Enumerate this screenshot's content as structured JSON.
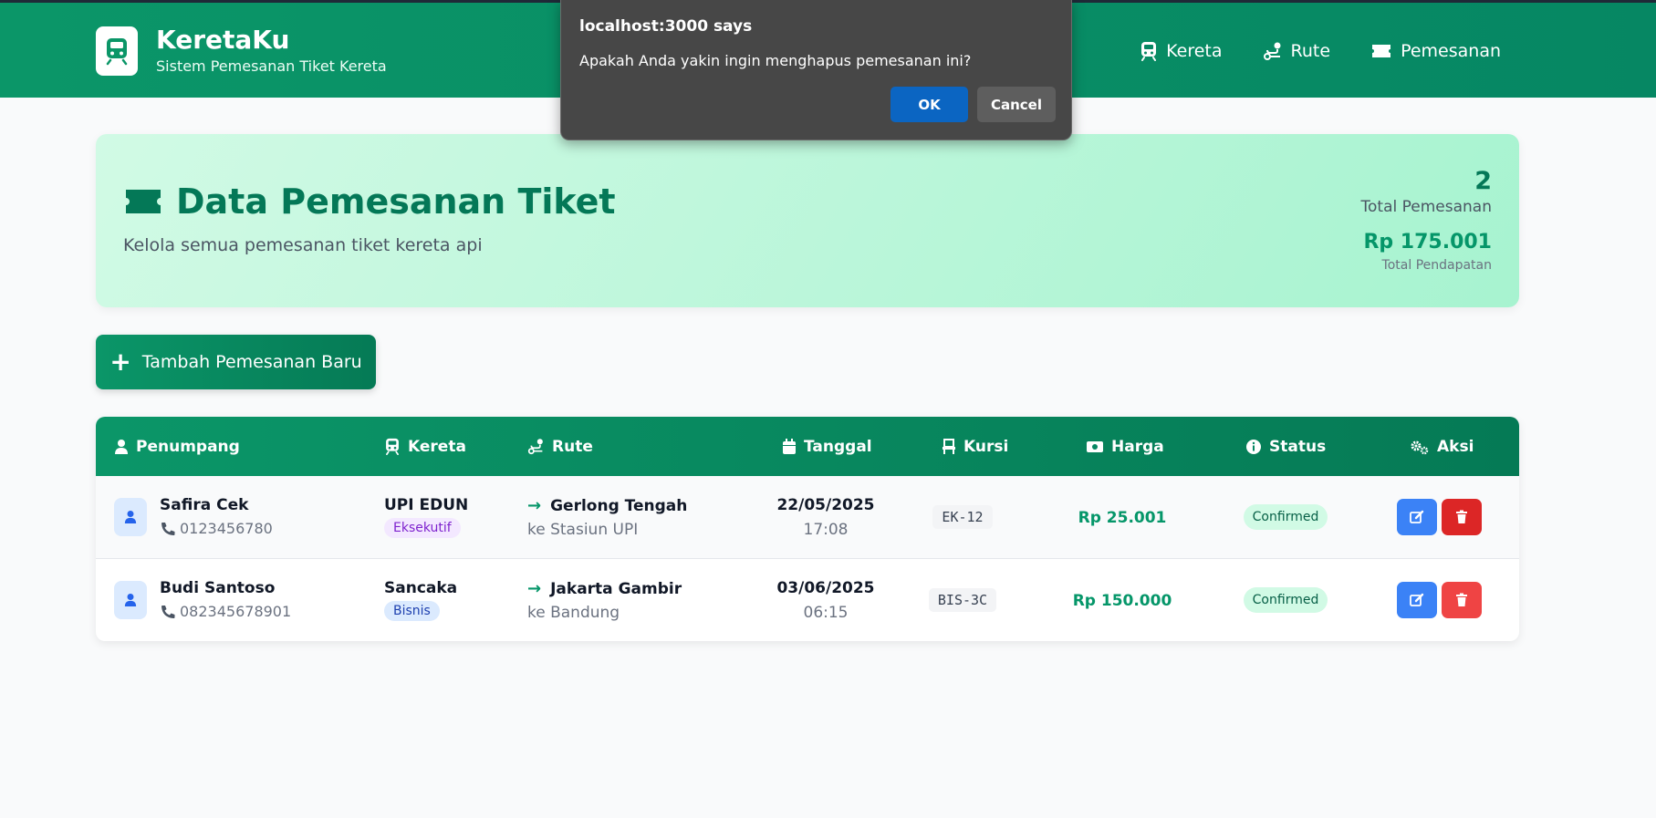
{
  "brand": {
    "title": "KeretaKu",
    "subtitle": "Sistem Pemesanan Tiket Kereta"
  },
  "nav": [
    {
      "label": "Kereta",
      "icon": "train-icon"
    },
    {
      "label": "Rute",
      "icon": "route-icon"
    },
    {
      "label": "Pemesanan",
      "icon": "ticket-icon"
    }
  ],
  "hero": {
    "title": "Data Pemesanan Tiket",
    "subtitle": "Kelola semua pemesanan tiket kereta api",
    "total_count": "2",
    "total_count_label": "Total Pemesanan",
    "total_revenue": "Rp 175.001",
    "total_revenue_label": "Total Pendapatan"
  },
  "add_button": {
    "label": "Tambah Pemesanan Baru"
  },
  "table": {
    "headers": [
      "Penumpang",
      "Kereta",
      "Rute",
      "Tanggal",
      "Kursi",
      "Harga",
      "Status",
      "Aksi"
    ],
    "rows": [
      {
        "name": "Safira Cek",
        "phone": "0123456780",
        "train": "UPI EDUN",
        "class": "Eksekutif",
        "from": "Gerlong Tengah",
        "to": "ke Stasiun UPI",
        "date": "22/05/2025",
        "time": "17:08",
        "seat": "EK-12",
        "price": "Rp 25.001",
        "status": "Confirmed"
      },
      {
        "name": "Budi Santoso",
        "phone": "082345678901",
        "train": "Sancaka",
        "class": "Bisnis",
        "from": "Jakarta Gambir",
        "to": "ke Bandung",
        "date": "03/06/2025",
        "time": "06:15",
        "seat": "BIS-3C",
        "price": "Rp 150.000",
        "status": "Confirmed"
      }
    ]
  },
  "dialog": {
    "title": "localhost:3000 says",
    "message": "Apakah Anda yakin ingin menghapus pemesanan ini?",
    "ok_label": "OK",
    "cancel_label": "Cancel"
  },
  "colors": {
    "primary": "#0b9668",
    "primary_dark": "#057a55",
    "accent_blue": "#3b82f6",
    "danger": "#dc2626"
  }
}
